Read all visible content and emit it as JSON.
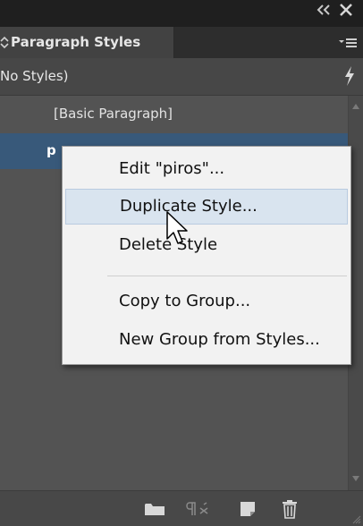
{
  "panel": {
    "tab_title": "Paragraph Styles",
    "style_row_label": "No Styles)"
  },
  "list": {
    "items": [
      {
        "label": "[Basic Paragraph]"
      },
      {
        "label": "p"
      }
    ],
    "selected_index": 1
  },
  "context_menu": {
    "items": [
      {
        "label": "Edit \"piros\"..."
      },
      {
        "label": "Duplicate Style..."
      },
      {
        "label": "Delete Style"
      },
      {
        "label": "Copy to Group..."
      },
      {
        "label": "New Group from Styles..."
      }
    ],
    "hovered_index": 1
  },
  "toolbar": {
    "icons": [
      "folder-icon",
      "clear-overrides-icon",
      "new-style-icon",
      "trash-icon"
    ]
  },
  "colors": {
    "selection": "#38597a",
    "menu_hover": "#d9e4ef",
    "panel_bg": "#535353"
  }
}
